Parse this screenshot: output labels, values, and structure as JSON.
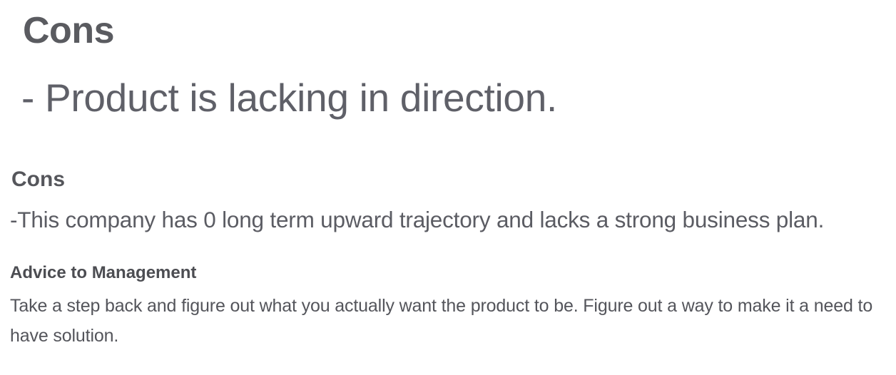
{
  "snippet_1": {
    "heading": "Cons",
    "body": "- Product is lacking in direction."
  },
  "snippet_2": {
    "heading": "Cons",
    "body": "-This company has 0 long term upward trajectory and lacks a strong business plan."
  },
  "snippet_3": {
    "heading": "Advice to Management",
    "body": "Take a step back and figure out what you actually want the product to be. Figure out a way to make it a need to have solution."
  },
  "colors": {
    "background": "#ffffff",
    "heading_text": "#55565b",
    "body_text": "#5b5c63"
  }
}
